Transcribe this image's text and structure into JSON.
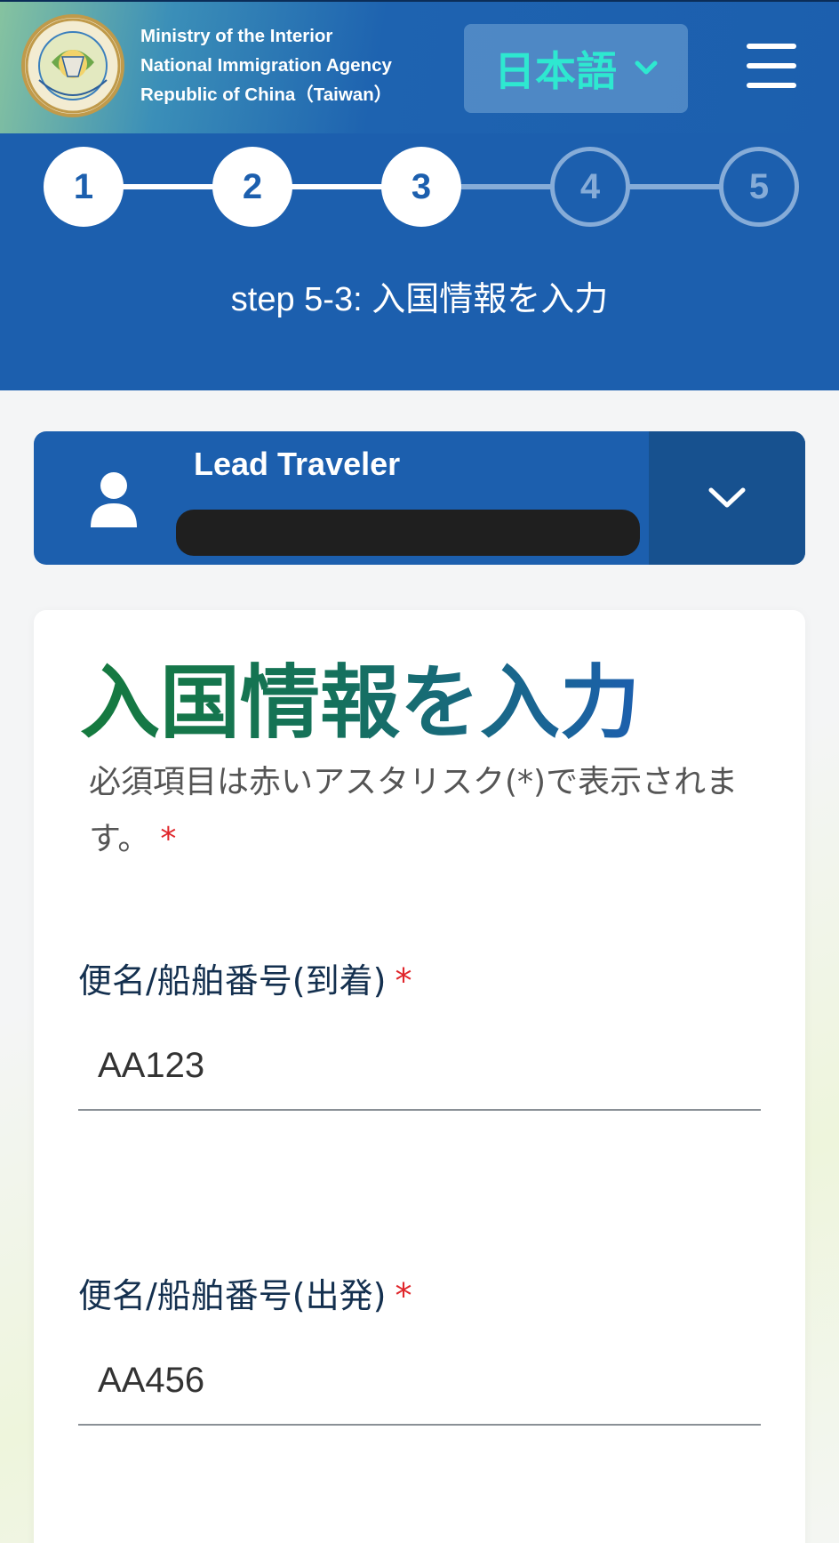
{
  "header": {
    "agency_lines": [
      "Ministry of the Interior",
      "National Immigration Agency",
      "Republic of China（Taiwan）"
    ],
    "logo_text": "National Immigration Agency",
    "language_button": "日本語"
  },
  "stepper": {
    "steps": [
      "1",
      "2",
      "3",
      "4",
      "5"
    ],
    "current_step": 3,
    "title_prefix": "step 5-3: ",
    "title_text": "入国情報を入力"
  },
  "traveler": {
    "label": "Lead Traveler"
  },
  "form": {
    "title": "入国情報を入力",
    "required_note": "必須項目は赤いアスタリスク(*)で表示されます。",
    "required_marker": "*",
    "fields": [
      {
        "label": "便名/船舶番号(到着)",
        "value": "AA123"
      },
      {
        "label": "便名/船舶番号(出発)",
        "value": "AA456"
      }
    ]
  },
  "colors": {
    "primary": "#1c5fae",
    "accent": "#2ee8d0",
    "required": "#e0262b",
    "title_gradient_start": "#157a3e"
  },
  "icons": {
    "language_chevron": "chevron-down-icon",
    "menu": "menu-icon",
    "avatar": "user-icon",
    "traveler_toggle": "chevron-down-icon"
  }
}
